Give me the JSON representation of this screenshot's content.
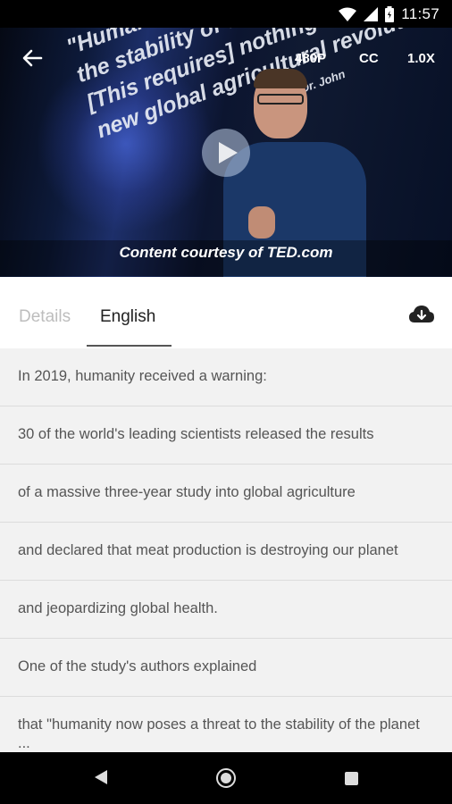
{
  "status_bar": {
    "time": "11:57",
    "icons": [
      "wifi-icon",
      "signal-icon",
      "battery-icon"
    ]
  },
  "video": {
    "slide_lines": [
      "\"Humanity now poses a threat to the stability of the planet",
      "the stability of the planet",
      "[This requires] nothing less than a",
      "new global agricultural revolution.\"",
      "Dr. John"
    ],
    "quality_label": "480P",
    "cc_label": "CC",
    "speed_label": "1.0X",
    "caption": "Content courtesy of TED.com"
  },
  "tabs": {
    "details": "Details",
    "english": "English"
  },
  "transcript": [
    "In 2019, humanity received a warning:",
    "30 of the world's leading scientists released the results",
    "of a massive three-year study into global agriculture",
    "and declared that meat production is destroying our planet",
    "and jeopardizing global health.",
    "One of the study's authors explained",
    "that \"humanity now poses a threat to the stability of the planet ..."
  ],
  "colors": {
    "accent": "#555555",
    "background": "#f2f2f2"
  }
}
